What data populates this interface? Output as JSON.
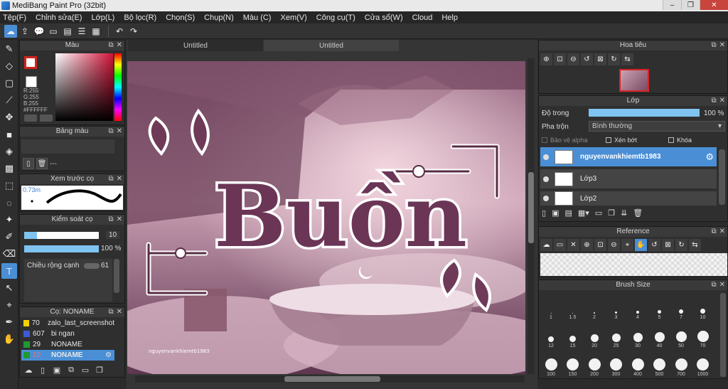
{
  "window": {
    "title": "MediBang Paint Pro (32bit)"
  },
  "menu": [
    "Tệp(F)",
    "Chỉnh sửa(E)",
    "Lớp(L)",
    "Bộ lọc(R)",
    "Chọn(S)",
    "Chụp(N)",
    "Màu (C)",
    "Xem(V)",
    "Công cụ(T)",
    "Cửa sổ(W)",
    "Cloud",
    "Help"
  ],
  "panels": {
    "color": {
      "title": "Màu",
      "rgb": [
        "R:255",
        "G:255",
        "B:255",
        "#FFFFFF"
      ]
    },
    "palette": {
      "title": "Bảng màu",
      "placeholder": "---"
    },
    "brush_preview": {
      "title": "Xem trước cọ",
      "size": "0.73m"
    },
    "brush_control": {
      "title": "Kiểm soát cọ",
      "size_value": "10",
      "opacity_value": "100 %",
      "width_label": "Chiều rộng cạnh",
      "width_value": "61"
    },
    "brush_list": {
      "title": "Cọ: NONAME",
      "items": [
        {
          "num": "70",
          "name": "zalo_last_screenshot",
          "color": "#f2d200"
        },
        {
          "num": "607",
          "name": "bi ngan",
          "color": "#3b5bd6"
        },
        {
          "num": "29",
          "name": "NONAME",
          "color": "#1e9a2f"
        },
        {
          "num": "10",
          "name": "NONAME",
          "color": "#1e9a2f"
        }
      ]
    },
    "navigator": {
      "title": "Hoa tiêu"
    },
    "layers": {
      "title": "Lớp",
      "opacity_label": "Độ trong",
      "opacity_value": "100 %",
      "blend_label": "Pha trộn",
      "blend_value": "Bình thường",
      "protect_alpha": "Bảo vệ alpha",
      "clipping": "Xén bớt",
      "lock": "Khóa",
      "items": [
        {
          "name": "nguyenvankhiemtb1983",
          "selected": true
        },
        {
          "name": "Lớp3",
          "selected": false
        },
        {
          "name": "Lớp2",
          "selected": false
        }
      ]
    },
    "reference": {
      "title": "Reference"
    },
    "brush_size": {
      "title": "Brush Size",
      "sizes": [
        "1",
        "1.5",
        "2",
        "3",
        "4",
        "5",
        "7",
        "10",
        "12",
        "15",
        "20",
        "25",
        "30",
        "40",
        "50",
        "70",
        "100",
        "150",
        "200",
        "300",
        "400",
        "500",
        "700",
        "1000"
      ]
    }
  },
  "tabs": [
    "Untitled",
    "Untitled"
  ],
  "canvas": {
    "text": "Buồn",
    "signature": "nguyenvankhiemtb1983"
  }
}
